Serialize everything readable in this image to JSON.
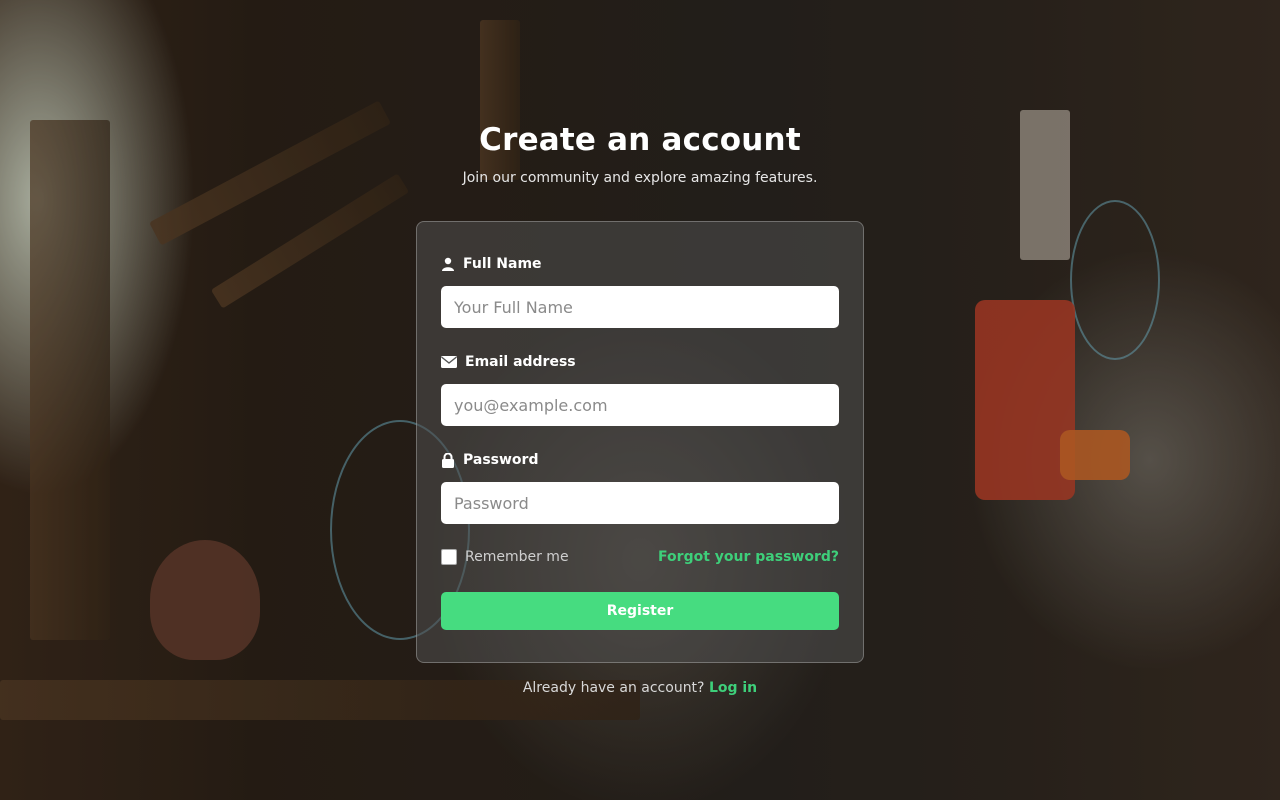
{
  "page": {
    "title": "Create an account",
    "subtitle": "Join our community and explore amazing features."
  },
  "form": {
    "full_name": {
      "label": "Full Name",
      "placeholder": "Your Full Name",
      "value": "",
      "icon": "user-icon"
    },
    "email": {
      "label": "Email address",
      "placeholder": "you@example.com",
      "value": "",
      "icon": "envelope-icon"
    },
    "password": {
      "label": "Password",
      "placeholder": "Password",
      "value": "",
      "icon": "lock-icon"
    },
    "remember_label": "Remember me",
    "remember_checked": false,
    "forgot_link": "Forgot your password?",
    "submit_label": "Register"
  },
  "footer": {
    "prompt": "Already have an account?",
    "login_link": "Log in"
  },
  "colors": {
    "accent": "#46dc80",
    "link": "#3ecf7a",
    "card_bg": "rgba(80,80,80,0.55)"
  }
}
